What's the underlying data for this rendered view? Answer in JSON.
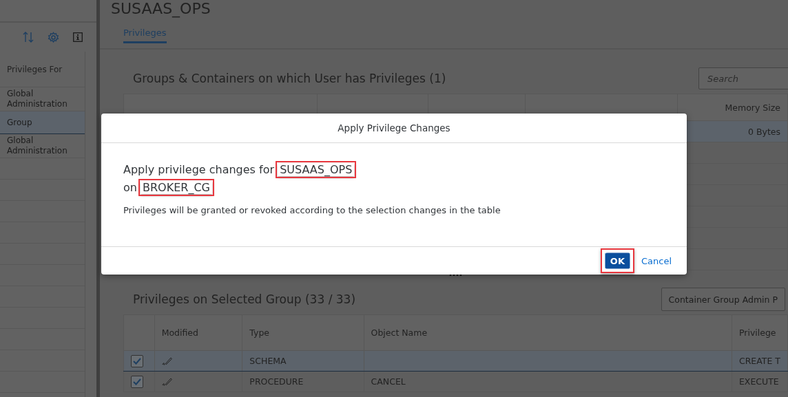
{
  "page": {
    "title": "SUSAAS_OPS"
  },
  "sidebar": {
    "header": "Privileges For",
    "items": [
      {
        "label": "Global Administration",
        "selected": false
      },
      {
        "label": "Group",
        "selected": true
      },
      {
        "label": "Global Administration",
        "selected": false
      }
    ]
  },
  "tabs": [
    {
      "label": "Privileges",
      "selected": true
    }
  ],
  "groups_section": {
    "title": "Groups & Containers on which User has Privileges (1)",
    "search": {
      "placeholder": "Search"
    },
    "columns": [
      "Memory Size"
    ],
    "rows": [
      {
        "memory_size": "0 Bytes",
        "selected": true
      }
    ]
  },
  "splitter": "....",
  "privileges_section": {
    "title": "Privileges on Selected Group (33 / 33)",
    "filter": "Container Group Admin P",
    "columns": [
      "Modified",
      "Type",
      "Object Name",
      "Privilege"
    ],
    "rows": [
      {
        "checked": true,
        "type": "SCHEMA",
        "object_name": "",
        "privilege": "CREATE T",
        "selected": true
      },
      {
        "checked": true,
        "type": "PROCEDURE",
        "object_name": "CANCEL",
        "privilege": "EXECUTE",
        "selected": false
      }
    ]
  },
  "dialog": {
    "title": "Apply Privilege Changes",
    "message_lines": [
      [
        {
          "text": "Apply privilege changes for "
        },
        {
          "text": "SUSAAS_OPS",
          "highlighted": true
        }
      ],
      [
        {
          "text": "on "
        },
        {
          "text": "BROKER_CG",
          "highlighted": true
        }
      ]
    ],
    "note": "Privileges will be granted or revoked according to the selection changes in the table",
    "buttons": [
      {
        "label": "OK",
        "kind": "primary",
        "highlighted": true
      },
      {
        "label": "Cancel",
        "kind": "link"
      }
    ]
  }
}
